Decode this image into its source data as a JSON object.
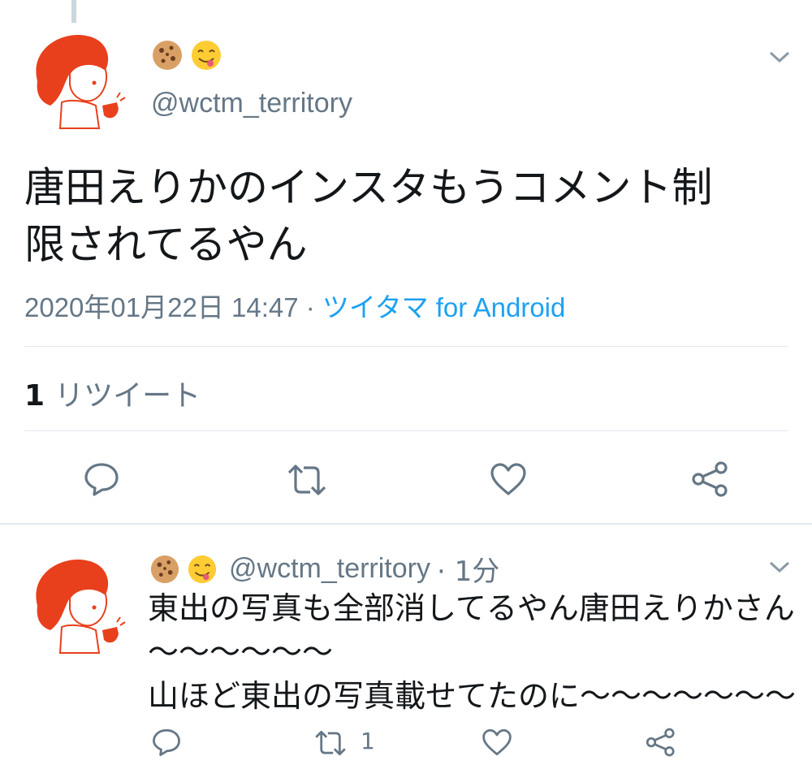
{
  "tweet": {
    "emoji": [
      "cookie-emoji",
      "yum-face-emoji"
    ],
    "handle": "@wctm_territory",
    "text_line1": "唐田えりかのインスタもうコメント制",
    "text_line2": "限されてるやん",
    "timestamp": "2020年01月22日 14:47",
    "separator": " · ",
    "client": "ツイタマ for Android",
    "retweet_count": "1",
    "retweet_label": "リツイート"
  },
  "reply": {
    "handle": "@wctm_territory",
    "time": "· 1分",
    "lines": [
      "東出の写真も全部消してるやん唐田えりかさん",
      "〜〜〜〜〜〜",
      "山ほど東出の写真載せてたのに〜〜〜〜〜〜〜"
    ],
    "retweet_count": "1"
  },
  "colors": {
    "handle_gray": "#657786",
    "link_blue": "#1da1f2",
    "avatar_red": "#e8401c",
    "icon_gray": "#657786"
  }
}
